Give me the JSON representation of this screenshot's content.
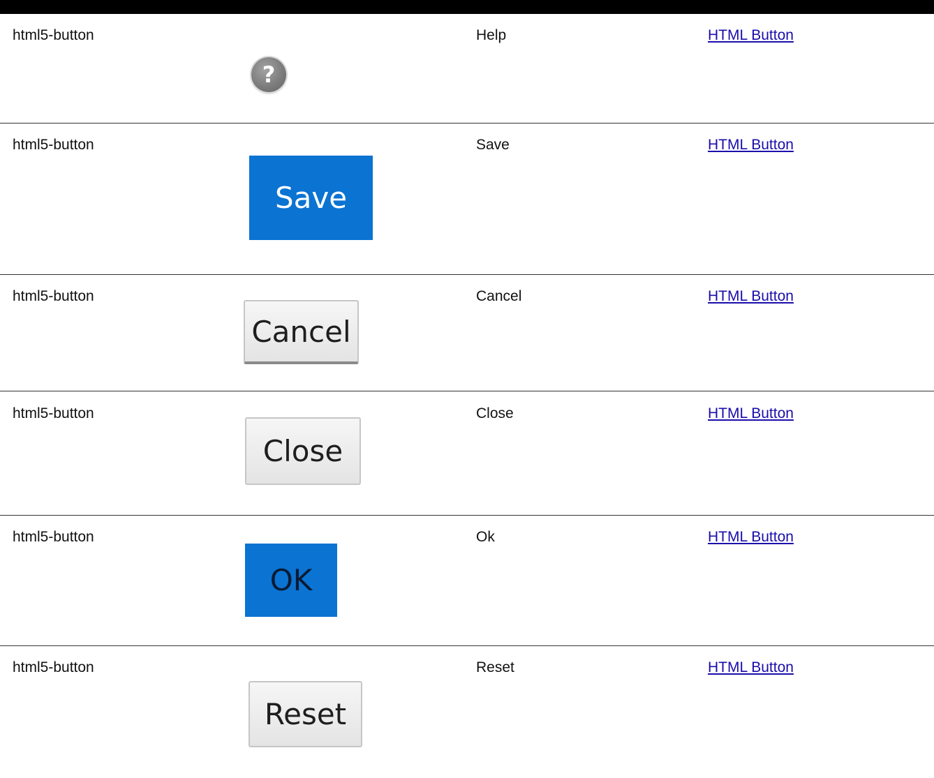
{
  "rows": [
    {
      "type": "html5-button",
      "label": "Help",
      "link": "HTML Button",
      "preview_text": "?"
    },
    {
      "type": "html5-button",
      "label": "Save",
      "link": "HTML Button",
      "preview_text": "Save"
    },
    {
      "type": "html5-button",
      "label": "Cancel",
      "link": "HTML Button",
      "preview_text": "Cancel"
    },
    {
      "type": "html5-button",
      "label": "Close",
      "link": "HTML Button",
      "preview_text": "Close"
    },
    {
      "type": "html5-button",
      "label": "Ok",
      "link": "HTML Button",
      "preview_text": "OK"
    },
    {
      "type": "html5-button",
      "label": "Reset",
      "link": "HTML Button",
      "preview_text": "Reset"
    }
  ],
  "colors": {
    "primary_button": "#0b73d2",
    "link": "#1a0dab",
    "header_bar": "#000000"
  },
  "icons": {
    "help": "help-icon"
  }
}
